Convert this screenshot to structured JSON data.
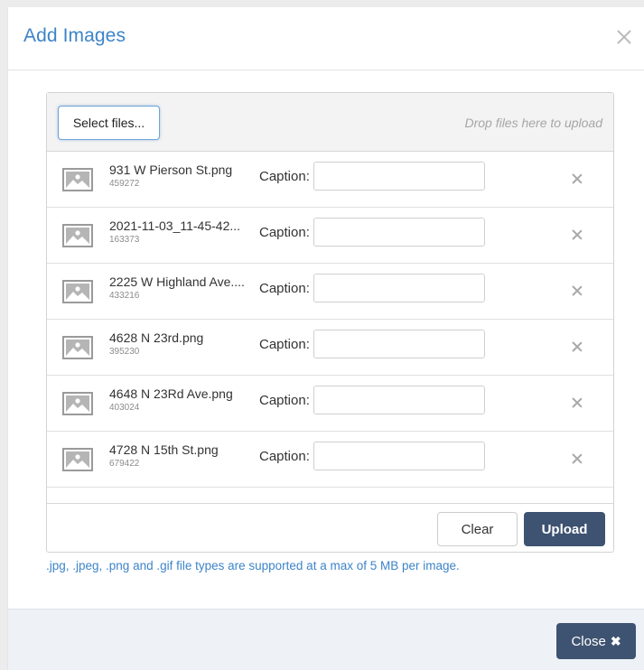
{
  "dialog": {
    "title": "Add Images"
  },
  "dropzone": {
    "select_label": "Select files...",
    "hint": "Drop files here to upload"
  },
  "files": [
    {
      "name": "931 W Pierson St.png",
      "size": "459272",
      "caption_label": "Caption:",
      "caption_value": ""
    },
    {
      "name": "2021-11-03_11-45-42...",
      "size": "163373",
      "caption_label": "Caption:",
      "caption_value": ""
    },
    {
      "name": "2225 W Highland Ave....",
      "size": "433216",
      "caption_label": "Caption:",
      "caption_value": ""
    },
    {
      "name": "4628 N 23rd.png",
      "size": "395230",
      "caption_label": "Caption:",
      "caption_value": ""
    },
    {
      "name": "4648 N 23Rd Ave.png",
      "size": "403024",
      "caption_label": "Caption:",
      "caption_value": ""
    },
    {
      "name": "4728 N 15th St.png",
      "size": "679422",
      "caption_label": "Caption:",
      "caption_value": ""
    }
  ],
  "actions": {
    "clear_label": "Clear",
    "upload_label": "Upload"
  },
  "support_note": ".jpg, .jpeg, .png and .gif file types are supported at a max of 5 MB per image.",
  "footer": {
    "close_label": "Close",
    "close_icon": "times-icon"
  },
  "colors": {
    "accent_blue": "#3d84c8",
    "button_dark": "#3e5371",
    "footer_bg": "#eef1f6"
  },
  "icons": {
    "file_thumb": "image-placeholder-icon",
    "remove": "remove-x-icon",
    "dialog_close": "close-icon"
  }
}
